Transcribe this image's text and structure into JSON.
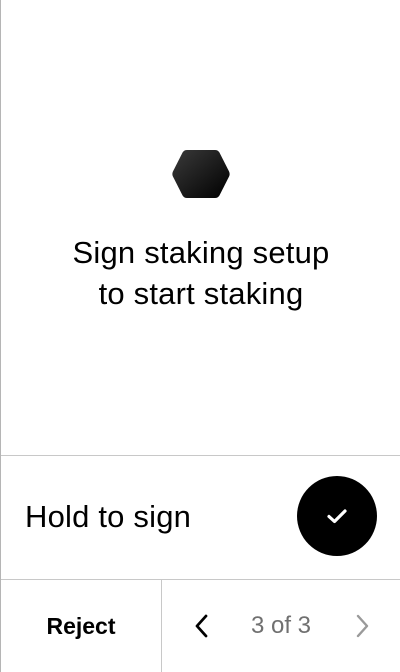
{
  "main": {
    "icon": "hexagon-logo-icon",
    "title_line1": "Sign staking setup",
    "title_line2": "to start staking"
  },
  "action": {
    "hold_label": "Hold to sign",
    "confirm_icon": "checkmark-icon"
  },
  "footer": {
    "reject_label": "Reject",
    "prev_icon": "chevron-left-icon",
    "next_icon": "chevron-right-icon",
    "page_indicator": "3 of 3",
    "current_page": 3,
    "total_pages": 3
  },
  "colors": {
    "background": "#ffffff",
    "primary": "#000000",
    "divider": "#c8c8c8",
    "muted_text": "#707070",
    "disabled_icon": "#9a9a9a"
  }
}
